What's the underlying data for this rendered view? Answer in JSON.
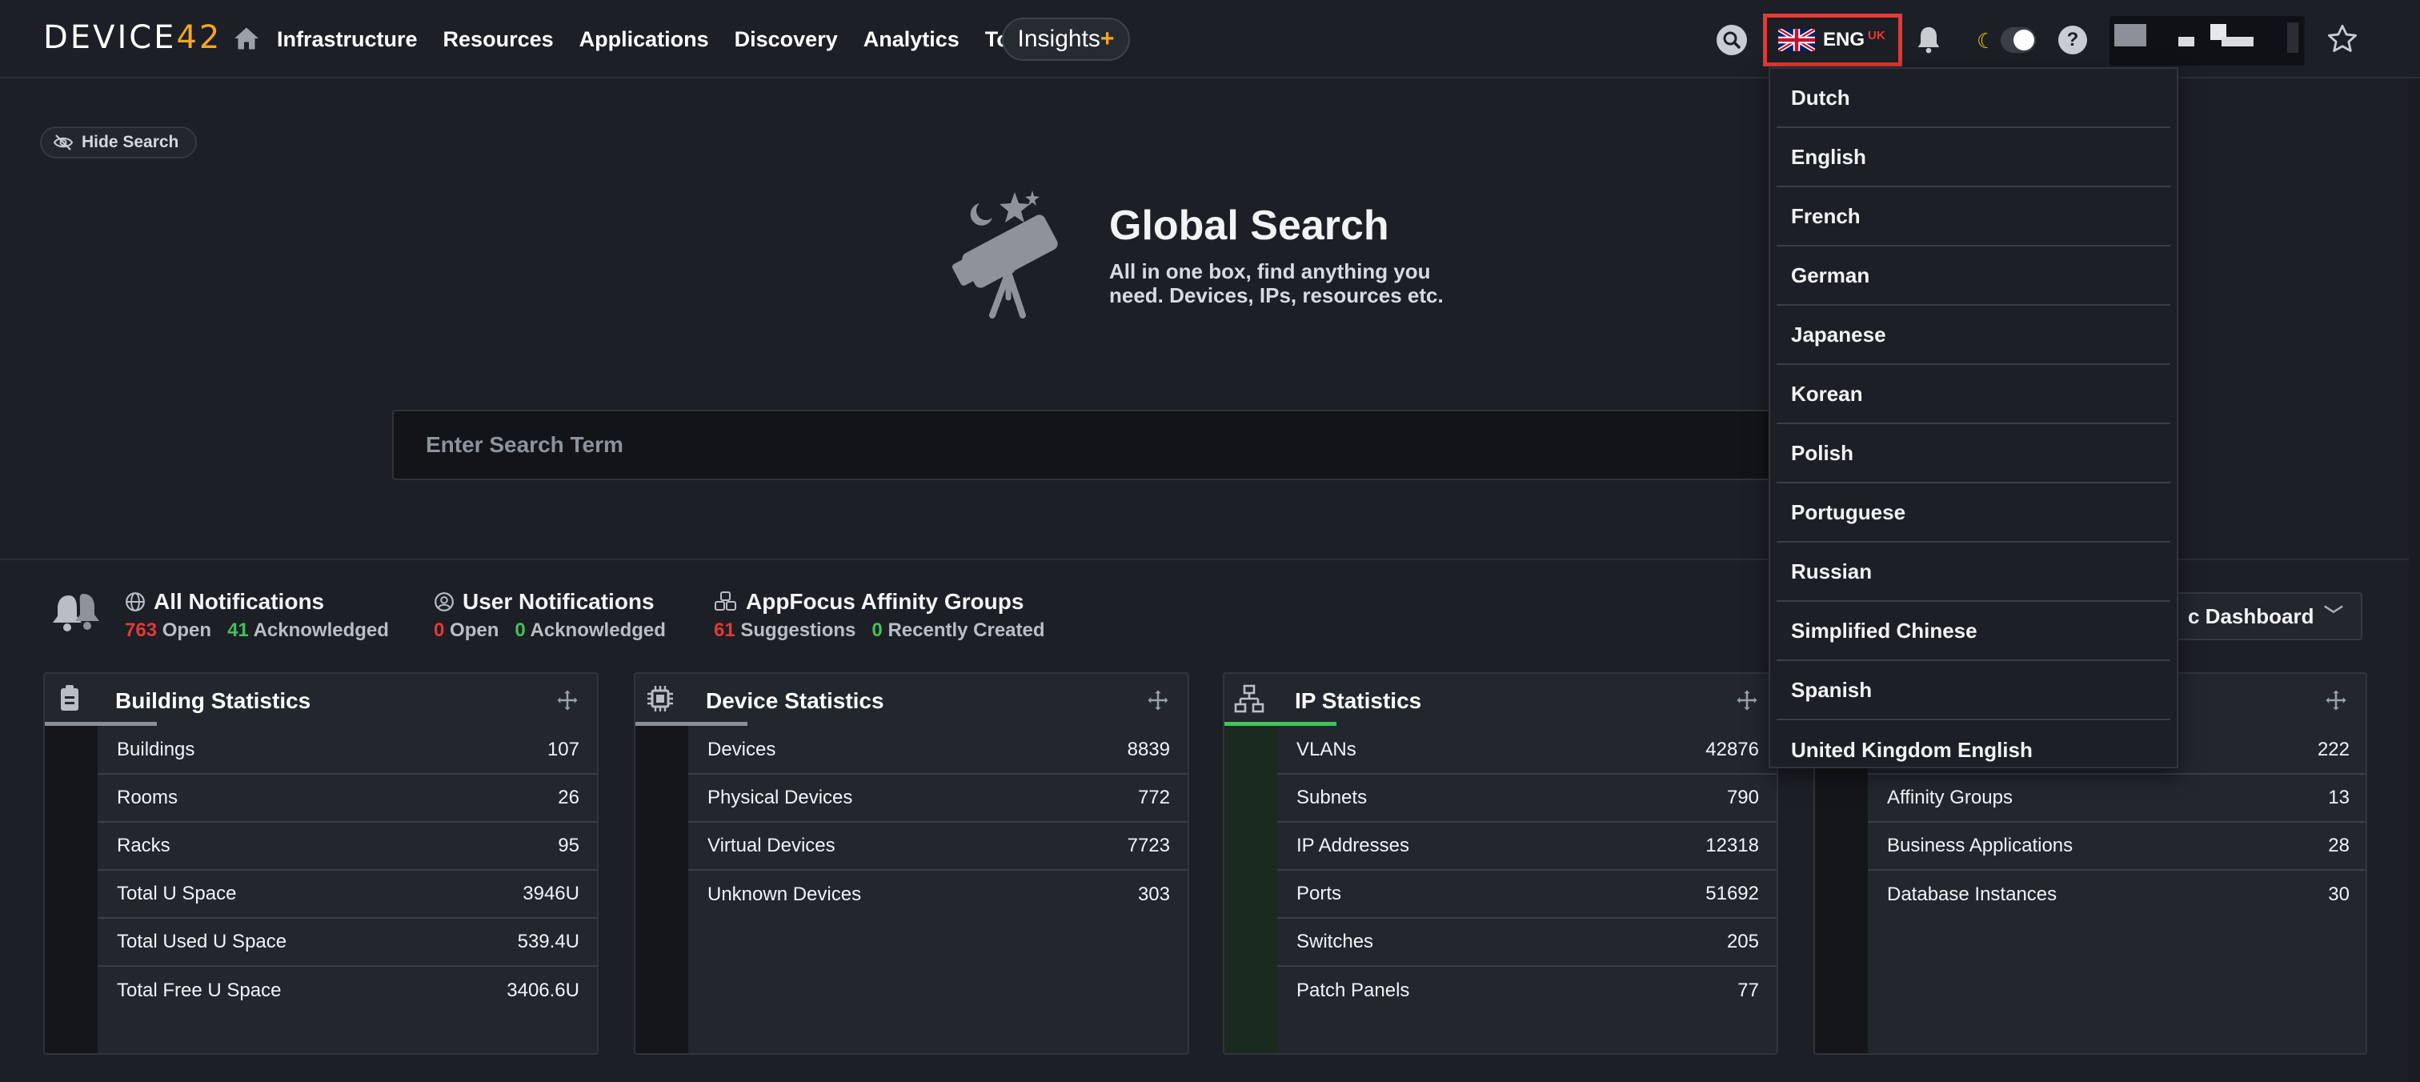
{
  "app": {
    "logo_main": "DEVICE",
    "logo_accent": "42"
  },
  "nav": {
    "items": [
      "Infrastructure",
      "Resources",
      "Applications",
      "Discovery",
      "Analytics",
      "Tools"
    ],
    "insights_label": "Insights",
    "insights_plus": "+"
  },
  "language": {
    "current_code": "ENG",
    "current_region": "UK",
    "options": [
      "Dutch",
      "English",
      "French",
      "German",
      "Japanese",
      "Korean",
      "Polish",
      "Portuguese",
      "Russian",
      "Simplified Chinese",
      "Spanish",
      "United Kingdom English"
    ]
  },
  "search": {
    "hide_label": "Hide Search",
    "title": "Global Search",
    "subtitle": "All in one box, find anything you need. Devices, IPs, resources etc.",
    "placeholder": "Enter Search Term"
  },
  "notifications": {
    "all": {
      "title": "All Notifications",
      "open_count": "763",
      "open_label": "Open",
      "ack_count": "41",
      "ack_label": "Acknowledged"
    },
    "user": {
      "title": "User Notifications",
      "open_count": "0",
      "open_label": "Open",
      "ack_count": "0",
      "ack_label": "Acknowledged"
    },
    "appfocus": {
      "title": "AppFocus Affinity Groups",
      "sugg_count": "61",
      "sugg_label": "Suggestions",
      "created_count": "0",
      "created_label": "Recently Created"
    }
  },
  "dashboard_select": {
    "visible_text": "c Dashboard"
  },
  "cards": {
    "building": {
      "title": "Building Statistics",
      "rows": [
        {
          "label": "Buildings",
          "value": "107"
        },
        {
          "label": "Rooms",
          "value": "26"
        },
        {
          "label": "Racks",
          "value": "95"
        },
        {
          "label": "Total U Space",
          "value": "3946U"
        },
        {
          "label": "Total Used U Space",
          "value": "539.4U"
        },
        {
          "label": "Total Free U Space",
          "value": "3406.6U"
        }
      ]
    },
    "device": {
      "title": "Device Statistics",
      "rows": [
        {
          "label": "Devices",
          "value": "8839"
        },
        {
          "label": "Physical Devices",
          "value": "772"
        },
        {
          "label": "Virtual Devices",
          "value": "7723"
        },
        {
          "label": "Unknown Devices",
          "value": "303"
        }
      ]
    },
    "ip": {
      "title": "IP Statistics",
      "rows": [
        {
          "label": "VLANs",
          "value": "42876"
        },
        {
          "label": "Subnets",
          "value": "790"
        },
        {
          "label": "IP Addresses",
          "value": "12318"
        },
        {
          "label": "Ports",
          "value": "51692"
        },
        {
          "label": "Switches",
          "value": "205"
        },
        {
          "label": "Patch Panels",
          "value": "77"
        }
      ]
    },
    "app": {
      "title": "",
      "rows": [
        {
          "label": "",
          "value": "222"
        },
        {
          "label": "Affinity Groups",
          "value": "13"
        },
        {
          "label": "Business Applications",
          "value": "28"
        },
        {
          "label": "Database Instances",
          "value": "30"
        }
      ]
    }
  },
  "colors": {
    "background": "#1c1f25",
    "accent_orange": "#f5a623",
    "danger_red": "#e53935",
    "success_green": "#43c05a"
  }
}
